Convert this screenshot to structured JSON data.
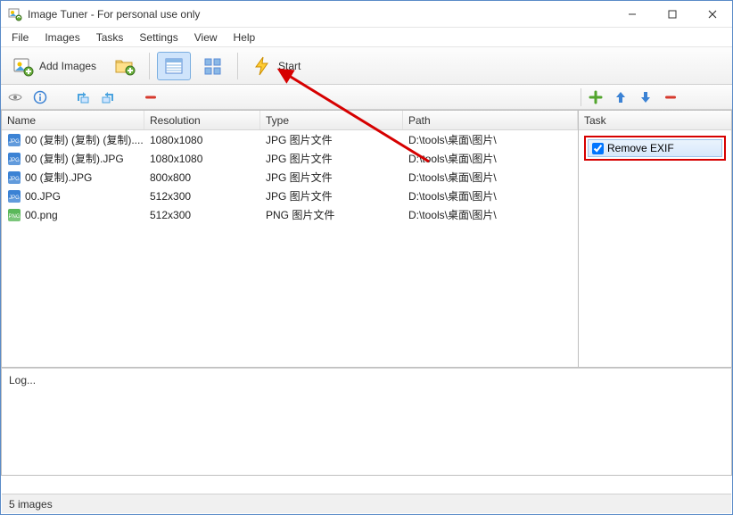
{
  "window": {
    "title": "Image Tuner - For personal use only"
  },
  "menu": {
    "file": "File",
    "images": "Images",
    "tasks": "Tasks",
    "settings": "Settings",
    "view": "View",
    "help": "Help"
  },
  "toolbar1": {
    "add_images": "Add Images",
    "start": "Start"
  },
  "columns": {
    "name": "Name",
    "resolution": "Resolution",
    "type": "Type",
    "path": "Path"
  },
  "files": [
    {
      "name": "00 (复制) (复制) (复制)....",
      "resolution": "1080x1080",
      "type": "JPG 图片文件",
      "path": "D:\\tools\\桌面\\图片\\",
      "ext": "jpg"
    },
    {
      "name": "00 (复制) (复制).JPG",
      "resolution": "1080x1080",
      "type": "JPG 图片文件",
      "path": "D:\\tools\\桌面\\图片\\",
      "ext": "jpg"
    },
    {
      "name": "00 (复制).JPG",
      "resolution": "800x800",
      "type": "JPG 图片文件",
      "path": "D:\\tools\\桌面\\图片\\",
      "ext": "jpg"
    },
    {
      "name": "00.JPG",
      "resolution": "512x300",
      "type": "JPG 图片文件",
      "path": "D:\\tools\\桌面\\图片\\",
      "ext": "jpg"
    },
    {
      "name": "00.png",
      "resolution": "512x300",
      "type": "PNG 图片文件",
      "path": "D:\\tools\\桌面\\图片\\",
      "ext": "png"
    }
  ],
  "task_panel": {
    "header": "Task",
    "tasks": [
      {
        "label": "Remove EXIF",
        "checked": true
      }
    ]
  },
  "log": {
    "text": "Log..."
  },
  "status": {
    "text": "5 images"
  }
}
